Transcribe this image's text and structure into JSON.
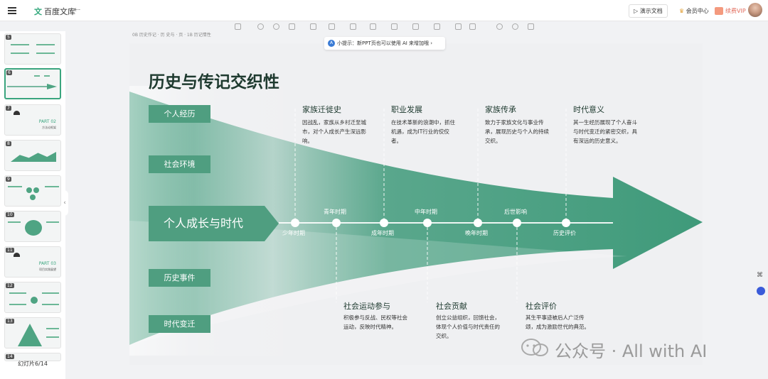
{
  "app": {
    "logo_text": "百度文库",
    "logo_mark": "文",
    "back": "⇠"
  },
  "header": {
    "present_label": "▷ 演示文档",
    "member_label": "会员中心",
    "vip_label": "续费VIP"
  },
  "tip": {
    "icon": "A",
    "text": "小提示：新PPT页也可以使用 AI 来增加哦 ›"
  },
  "breadcrumb_text": "0B 历史作记 · 历 史与 · 页 · 1B 历记情性",
  "sidebar": {
    "slide_counter": "幻灯片6/14",
    "thumbs": [
      {
        "num": "5"
      },
      {
        "num": "6"
      },
      {
        "num": "7",
        "part": "PART 02",
        "sub": "方法论框架"
      },
      {
        "num": "8"
      },
      {
        "num": "9"
      },
      {
        "num": "10"
      },
      {
        "num": "11",
        "part": "PART 03",
        "sub": "项目实践展望"
      },
      {
        "num": "12"
      },
      {
        "num": "13"
      },
      {
        "num": "14"
      }
    ]
  },
  "slide": {
    "title": "历史与传记交织性",
    "left_labels": [
      "个人经历",
      "社会环境",
      "历史事件",
      "时代变迁"
    ],
    "main_label": "个人成长与时代",
    "stages_below": [
      "少年时期",
      "成年时期",
      "晚年时期",
      "历史评价"
    ],
    "stages_above": [
      "青年时期",
      "中年时期",
      "后世影响"
    ],
    "top_columns": [
      {
        "title": "家族迁徙史",
        "body": "因战乱，家族从乡村迁至城市，对个人成长产生深远影响。"
      },
      {
        "title": "职业发展",
        "body": "在技术革新的浪潮中，抓住机遇，成为IT行业的佼佼者。"
      },
      {
        "title": "家族传承",
        "body": "致力于家族文化与事业传承，展现历史与个人的持续交织。"
      },
      {
        "title": "时代意义",
        "body": "其一生经历展现了个人奋斗与时代变迁的紧密交织，具有深远的历史意义。"
      }
    ],
    "bottom_columns": [
      {
        "title": "社会运动参与",
        "body": "积极参与反战、民权等社会运动，反映时代精神。"
      },
      {
        "title": "社会贡献",
        "body": "创立公益组织，回馈社会，体现个人价值与时代责任的交织。"
      },
      {
        "title": "社会评价",
        "body": "其生平事迹被后人广泛传颂，成为激励世代的典范。"
      }
    ]
  },
  "watermark": "公众号 · All with AI",
  "colors": {
    "accent": "#4f9e80",
    "arrow_dark": "#3f9a7a",
    "title": "#1e3a2f"
  }
}
